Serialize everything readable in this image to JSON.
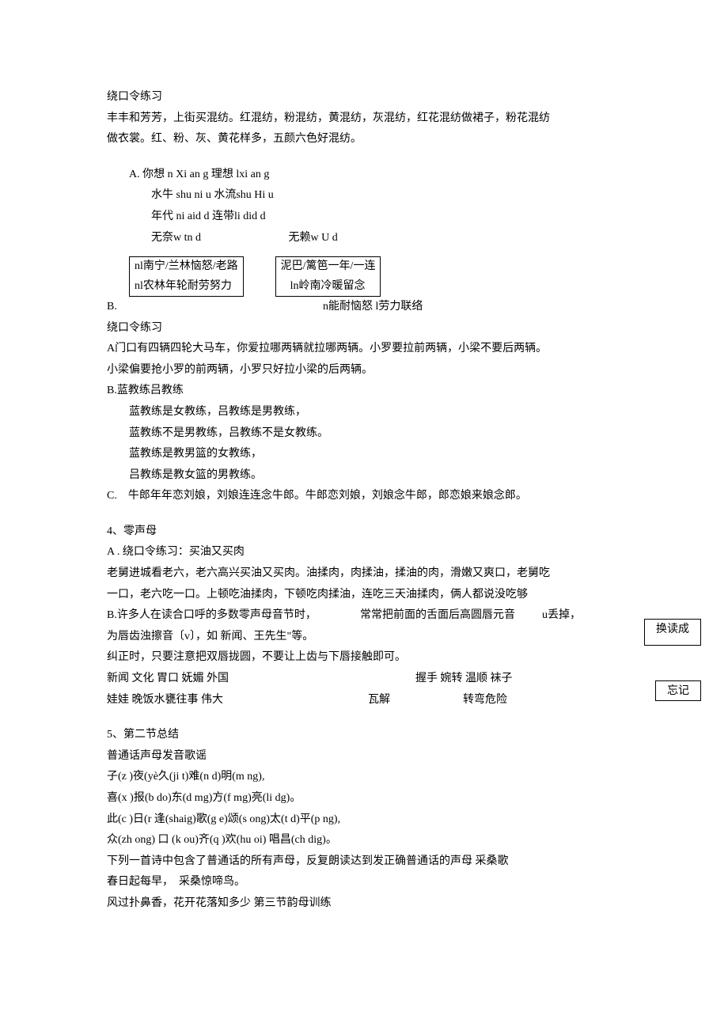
{
  "s1": {
    "title": "绕口令练习",
    "line1": "丰丰和芳芳，上街买混纺。红混纺，粉混纺，黄混纺，灰混纺，红花混纺做裙子，粉花混纺",
    "line2": "做衣裳。红、粉、灰、黄花样多，五颜六色好混纺。"
  },
  "listA": {
    "label": "A.",
    "row1": "你想 n Xi an g 理想  lxi an g",
    "row2": "水牛 shu ni u 水流shu Hi u",
    "row3": "年代 ni aid d 连带li did d",
    "row4_left": "无奈w tn d",
    "row4_right": "无赖w U d"
  },
  "tables": {
    "left": {
      "r1": "nl南宁/兰林恼怒/老路",
      "r2": "nl农林年轮耐劳努力"
    },
    "right": {
      "r1": "泥巴/篱笆一年/一连",
      "r2": "ln岭南冷暖留念"
    },
    "b_label": "B.",
    "after": "n能耐恼怒 l劳力联络"
  },
  "s2": {
    "title": "绕口令练习",
    "A1": "A门口有四辆四轮大马车，你爱拉哪两辆就拉哪两辆。小罗要拉前两辆，小梁不要后两辆。",
    "A2": "小梁偏要抢小罗的前两辆，小罗只好拉小梁的后两辆。",
    "B_title": "B.蓝教练吕教练",
    "B1": "蓝教练是女教练，吕教练是男教练，",
    "B2": "蓝教练不是男教练，吕教练不是女教练。",
    "B3": "蓝教练是教男篮的女教练，",
    "B4": "吕教练是教女篮的男教练。",
    "C": "C.　牛郎年年恋刘娘，刘娘连连念牛郎。牛郎恋刘娘，刘娘念牛郎，郎恋娘来娘念郎。"
  },
  "s4": {
    "title": "4、零声母",
    "A1": "A . 绕口令练习：买油又买肉",
    "A2": "老舅进城看老六，老六高兴买油又买肉。油揉肉，肉揉油，揉油的肉，滑嫩又爽口，老舅吃",
    "A3": "一口，老六吃一口。上顿吃油揉肉，下顿吃肉揉油，连吃三天油揉肉，俩人都说没吃够",
    "B1_a": "B.许多人在读合口呼的多数零声母音节时，",
    "B1_b": "常常把前面的舌面后高圆唇元音",
    "B1_c": "u丢掉，",
    "B2": "为唇齿浊擦音〔v〕，如 新闻、王先生\"等。",
    "B3": "纠正时，只要注意把双唇拢圆，不要让上齿与下唇接触即可。",
    "row1_left": "新闻 文化 胃口 妩媚 外国",
    "row1_right": "握手 婉转 温顺 袜子",
    "row2_left": "娃娃 晚饭水甕往事 伟大",
    "row2_mid": "瓦解",
    "row2_right": "转弯危险"
  },
  "side": {
    "upper": "换读成",
    "lower": "忘记"
  },
  "s5": {
    "title": "5、第二节总结",
    "l1": "普通话声母发音歌谣",
    "l2": "子(z )夜(yè久(ji t)难(n d)明(m ng),",
    "l3": "喜(x )报(b do)东(d mg)方(f mg)亮(li dg)。",
    "l4": "此(c )日(r 逢(shaig)歌(g e)颂(s ong)太(t d)平(p ng),",
    "l5": "众(zh ong) 口 (k ou)齐(q )欢(hu oi) 唱昌(ch dig)。",
    "l6": "下列一首诗中包含了普通话的所有声母，反复朗读达到发正确普通话的声母 采桑歌",
    "l7": "春日起每早，　采桑惊啼鸟。",
    "l8": "风过扑鼻香，花开花落知多少 第三节韵母训练"
  }
}
